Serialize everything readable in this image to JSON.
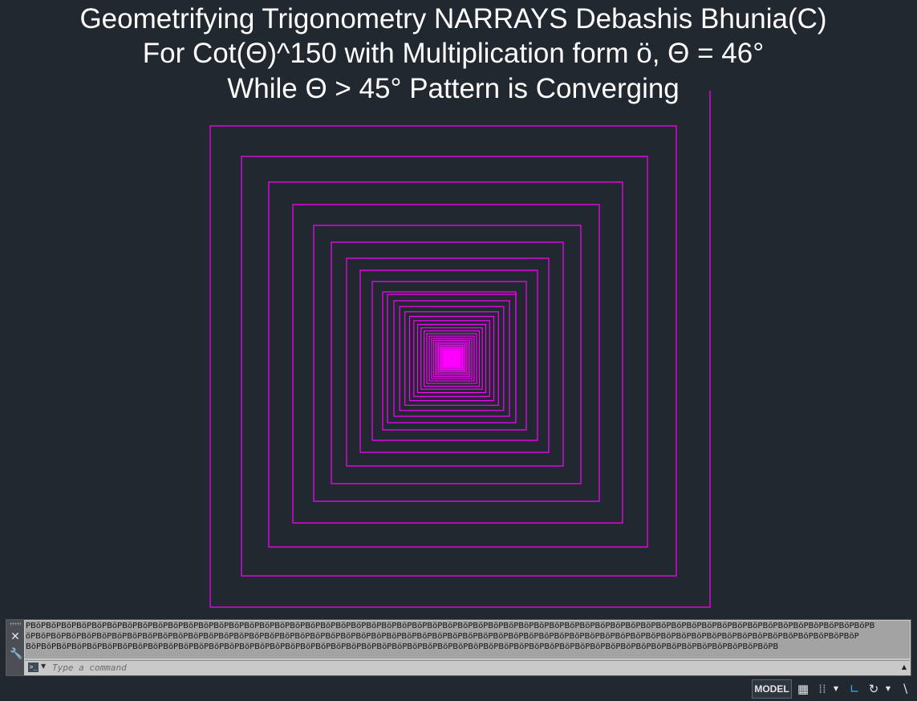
{
  "title": {
    "line1": "Geometrifying Trigonometry NARRAYS Debashis Bhunia(C)",
    "line2": "For Cot(Θ)^150 with Multiplication form ö, Θ = 46°",
    "line3": "While Θ > 45° Pattern is Converging"
  },
  "drawing": {
    "stroke_color": "#ff00ff",
    "angle_deg": 46,
    "power": 150
  },
  "command_line": {
    "history": [
      "PBöPBöPBöPBöPBöPBöPBöPBöPBöPBöPBöPBöPBöPBöPBöPBöPBöPBöPBöPBöPBöPBöPBöPBöPBöPBöPBöPBöPBöPBöPBöPBöPBöPBöPBöPBöPBöPBöPBöPBöPBöPBöPBöPBöPBöPBöPBöPBöPBöPBöPBöPBöPBöPBöPBöPB",
      "öPBöPBöPBöPBöPBöPBöPBöPBöPBöPBöPBöPBöPBöPBöPBöPBöPBöPBöPBöPBöPBöPBöPBöPBöPBöPBöPBöPBöPBöPBöPBöPBöPBöPBöPBöPBöPBöPBöPBöPBöPBöPBöPBöPBöPBöPBöPBöPBöPBöPBöPBöPBöPBöPBöP",
      "BöPBöPBöPBöPBöPBöPBöPBöPBöPBöPBöPBöPBöPBöPBöPBöPBöPBöPBöPBöPBöPBöPBöPBöPBöPBöPBöPBöPBöPBöPBöPBöPBöPBöPBöPBöPBöPBöPBöPBöPBöPBöPBöPBöPBöPBöPBöPBöPBöPB"
    ],
    "placeholder": "Type a command",
    "prompt_icon": "command-prompt-icon",
    "close_icon": "close-icon",
    "customize_icon": "wrench-icon"
  },
  "status_bar": {
    "model_label": "MODEL",
    "icons": [
      "grid-icon",
      "snap-icon",
      "ortho-icon",
      "polar-icon",
      "osnap-icon"
    ]
  }
}
